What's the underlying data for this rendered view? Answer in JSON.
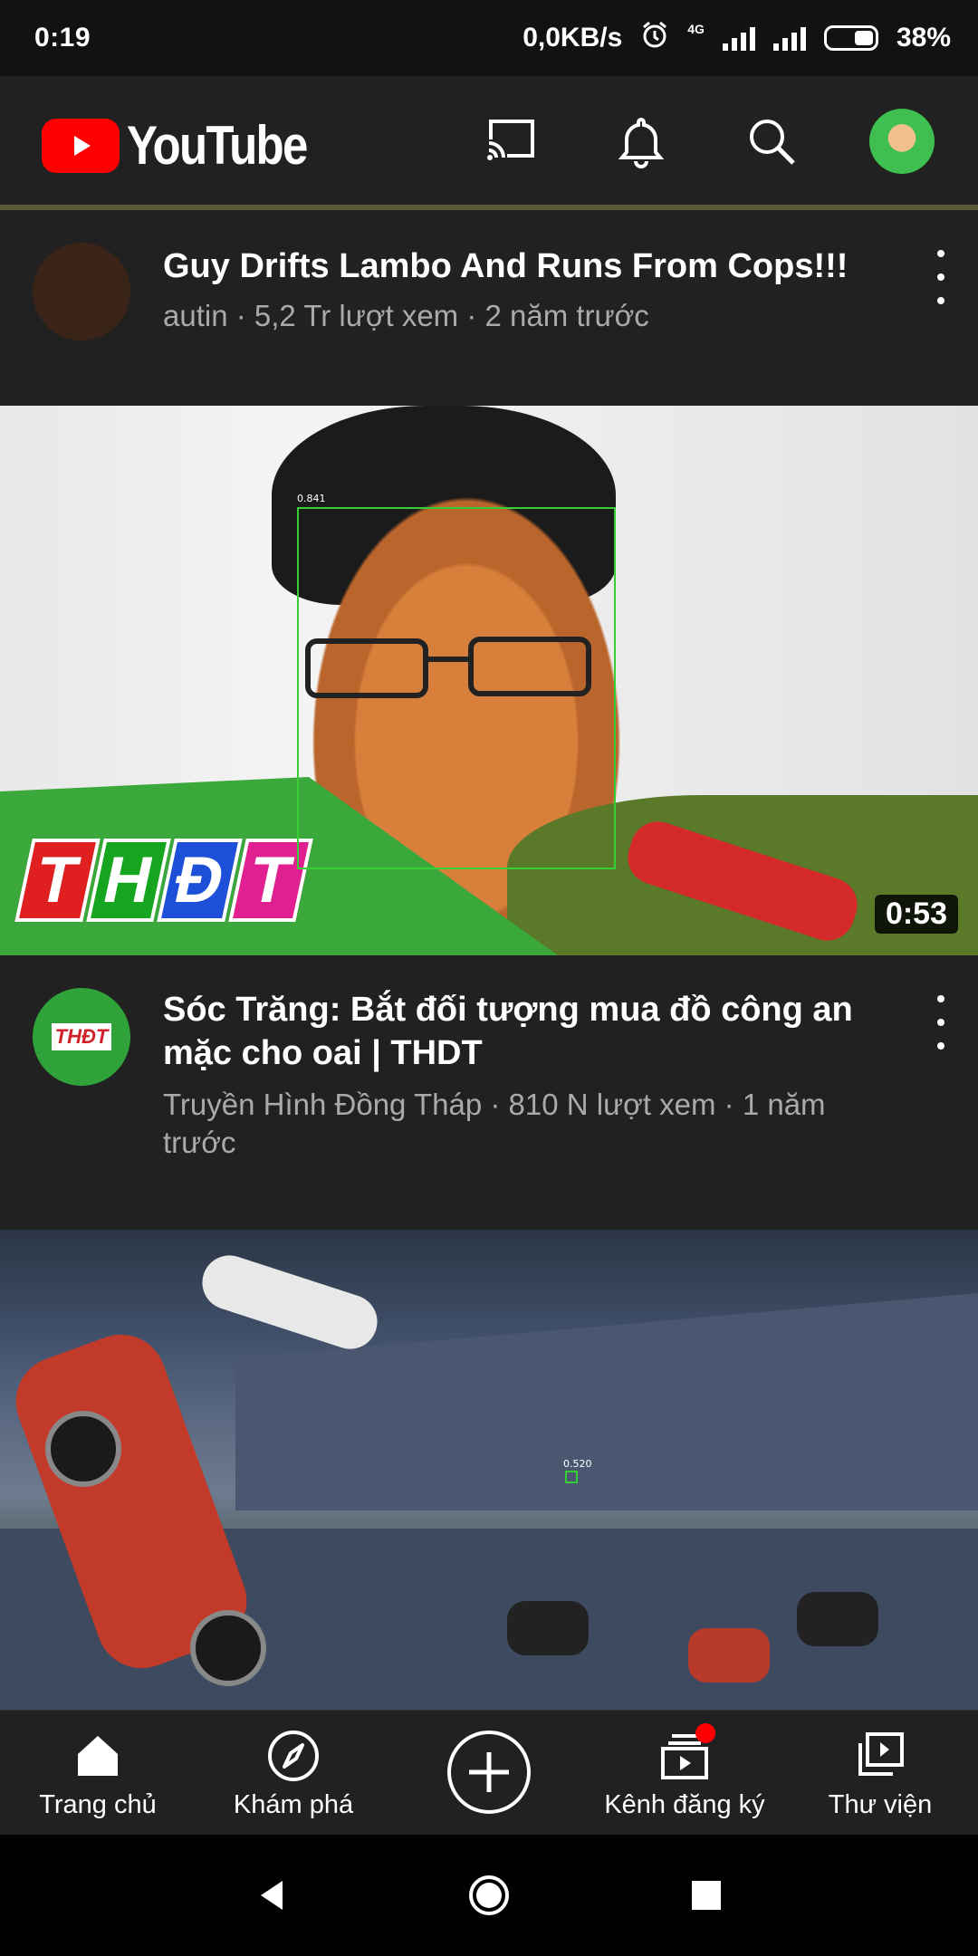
{
  "status_bar": {
    "time": "0:19",
    "network_speed": "0,0KB/s",
    "network_type": "4G",
    "battery": "38%"
  },
  "header": {
    "logo_text": "YouTube",
    "icons": [
      "cast-icon",
      "bell-icon",
      "search-icon",
      "account-avatar"
    ]
  },
  "feed": {
    "items": [
      {
        "title": "Guy Drifts Lambo And Runs From Cops!!!",
        "meta": "autin · 5,2 Tr lượt xem · 2 năm trước"
      },
      {
        "thumbnail_logo": "THĐT",
        "thumbnail_logo_letters": [
          "T",
          "H",
          "Đ",
          "T"
        ],
        "duration": "0:53",
        "detection_score": "0.841",
        "title": "Sóc Trăng: Bắt đối tượng mua đồ công an mặc cho oai | THDT",
        "meta": "Truyền Hình Đồng Tháp · 810 N lượt xem · 1 năm trước",
        "channel_avatar_text": "THĐT"
      },
      {
        "detection_score": "0.520"
      }
    ]
  },
  "bottom_nav": {
    "home": "Trang chủ",
    "explore": "Khám phá",
    "subscriptions": "Kênh đăng ký",
    "library": "Thư viện"
  },
  "colors": {
    "accent": "#ff0000",
    "header_bg": "#212121",
    "meta_text": "#aaaaaa"
  }
}
